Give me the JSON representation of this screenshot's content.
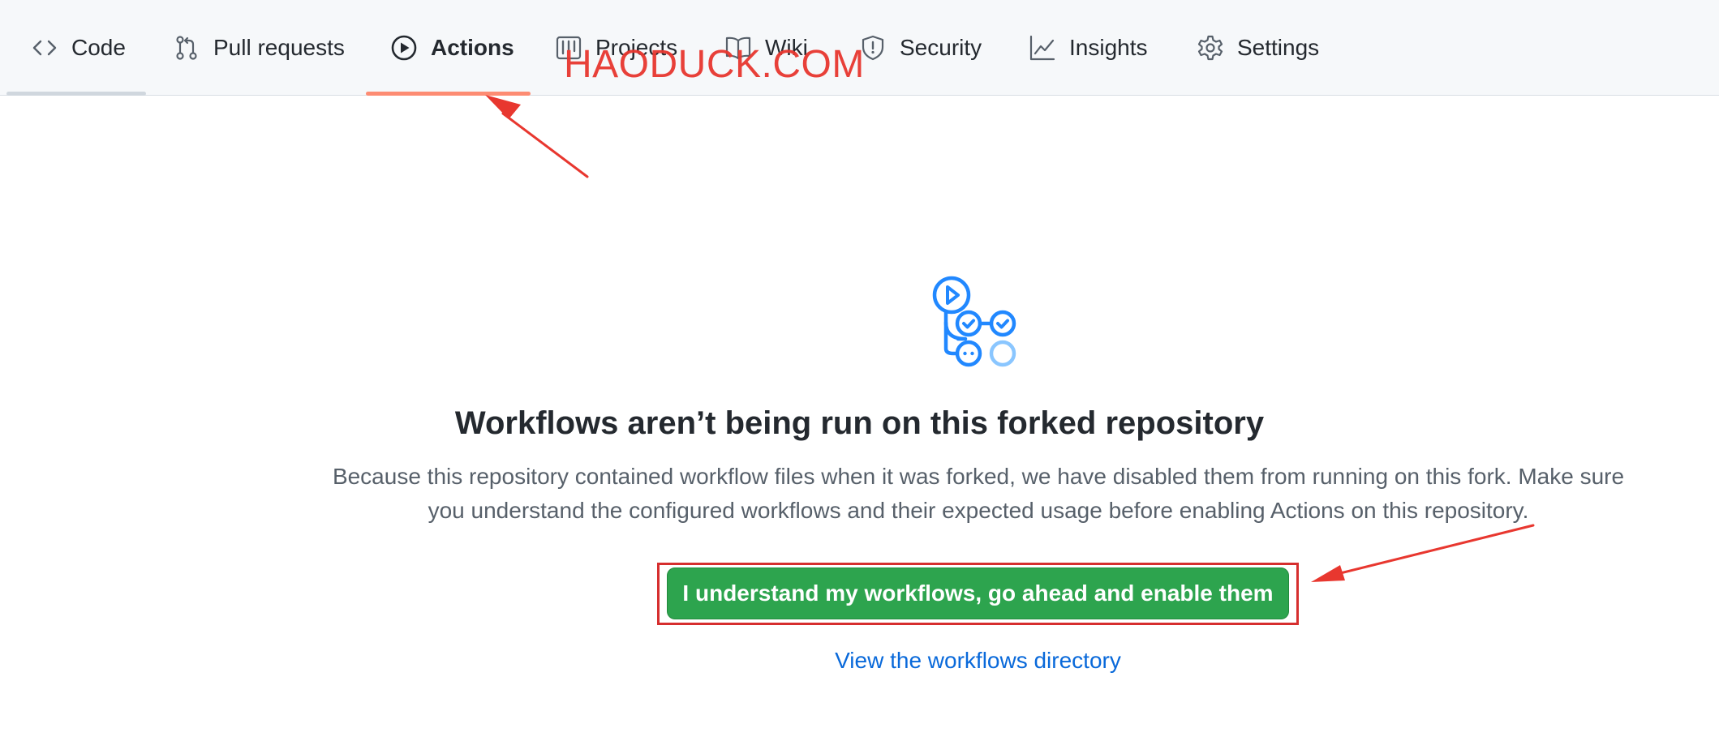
{
  "tabs": [
    {
      "label": "Code",
      "icon": "code-icon",
      "active": false
    },
    {
      "label": "Pull requests",
      "icon": "git-pull-request-icon",
      "active": false
    },
    {
      "label": "Actions",
      "icon": "play-icon",
      "active": true
    },
    {
      "label": "Projects",
      "icon": "project-icon",
      "active": false
    },
    {
      "label": "Wiki",
      "icon": "book-icon",
      "active": false
    },
    {
      "label": "Security",
      "icon": "shield-icon",
      "active": false
    },
    {
      "label": "Insights",
      "icon": "graph-icon",
      "active": false
    },
    {
      "label": "Settings",
      "icon": "gear-icon",
      "active": false
    }
  ],
  "watermark": "HAODUCK.COM",
  "empty_state": {
    "graphic_icon": "workflow-graph-icon",
    "heading": "Workflows aren’t being run on this forked repository",
    "description_line1": "Because this repository contained workflow files when it was forked, we have disabled them from running on this fork. Make sure",
    "description_line2": "you understand the configured workflows and their expected usage before enabling Actions on this repository.",
    "enable_button": "I understand my workflows, go ahead and enable them",
    "directory_link": "View the workflows directory"
  },
  "colors": {
    "active_tab_underline": "#fd8c73",
    "inactive_tab_underline": "#d0d7de",
    "primary_button": "#2da44e",
    "link": "#0969da",
    "annotation": "#e8372f",
    "graphic_blue": "#2188ff",
    "graphic_light_blue": "#8ac6ff"
  }
}
